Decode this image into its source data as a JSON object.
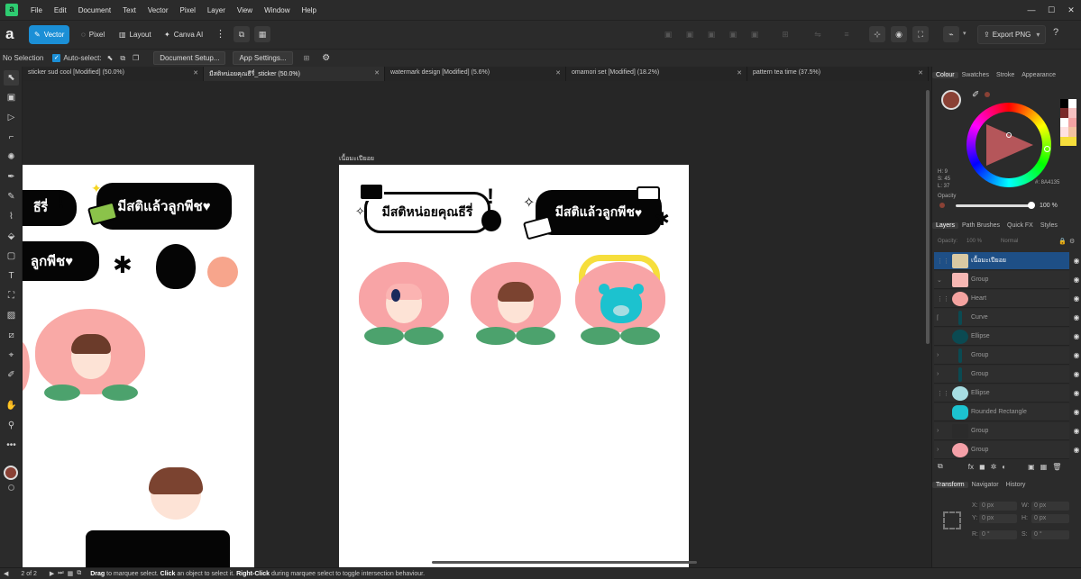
{
  "menubar": {
    "logo": "a",
    "items": [
      "File",
      "Edit",
      "Document",
      "Text",
      "Vector",
      "Pixel",
      "Layer",
      "View",
      "Window",
      "Help"
    ],
    "window_controls": [
      "—",
      "☐",
      "✕"
    ]
  },
  "toolbar": {
    "personas": [
      {
        "label": "Vector",
        "icon": "vector-persona-icon",
        "active": true
      },
      {
        "label": "Pixel",
        "icon": "pixel-persona-icon",
        "active": false
      },
      {
        "label": "Layout",
        "icon": "layout-persona-icon",
        "active": false
      },
      {
        "label": "Canva AI",
        "icon": "canva-ai-icon",
        "active": false
      }
    ],
    "export_label": "Export PNG",
    "accent_color": "#1b8fd6"
  },
  "contextbar": {
    "selection": "No Selection",
    "auto_select_label": "Auto-select:",
    "auto_select_checked": true,
    "document_setup": "Document Setup...",
    "app_settings": "App Settings..."
  },
  "tabs": [
    {
      "label": "sticker sud cool [Modified] (50.0%)",
      "active": false
    },
    {
      "label": "มีสติหน่อยคุณธีรี่_sticker (50.0%)",
      "active": true
    },
    {
      "label": "watermark design [Modified] (5.6%)",
      "active": false
    },
    {
      "label": "omamori set [Modified] (18.2%)",
      "active": false
    },
    {
      "label": "pattern tea time (37.5%)",
      "active": false
    }
  ],
  "canvas": {
    "artboard_label": "เนื้อมะเปียอย",
    "sticker_text_1": "มีสติหน่อยคุณธีรี่",
    "sticker_text_2": "มีสติแล้วลูกพีช",
    "left_sticker_text_1": "ธีรี่",
    "left_sticker_text_2": "ลูกพีช",
    "left_sticker_text_3": "มีสติแล้วลูกพีช"
  },
  "colour_panel": {
    "tabs": [
      "Colour",
      "Swatches",
      "Stroke",
      "Appearance"
    ],
    "h": "H: 9",
    "s": "S: 45",
    "l": "L: 37",
    "hex": "8A4135",
    "current_color": "#8A4135",
    "opacity_label": "Opacity",
    "opacity_value": "100 %"
  },
  "layers_panel": {
    "tabs": [
      "Layers",
      "Path Brushes",
      "Quick FX",
      "Styles"
    ],
    "opacity_label": "Opacity:",
    "opacity_value": "100 %",
    "blend_mode": "Normal",
    "layers": [
      {
        "name": "เนื้อมะเปียอย",
        "selected": true,
        "thumb": "#d9c9a3"
      },
      {
        "name": "Group",
        "selected": false,
        "thumb": "#f7b7b3"
      },
      {
        "name": "Heart",
        "selected": false,
        "thumb": "#f4a3a0"
      },
      {
        "name": "Curve",
        "selected": false,
        "thumb": "#0b4a52"
      },
      {
        "name": "Ellipse",
        "selected": false,
        "thumb": "#0b4a52"
      },
      {
        "name": "Group",
        "selected": false,
        "thumb": "#0b4a52"
      },
      {
        "name": "Group",
        "selected": false,
        "thumb": "#0b4a52"
      },
      {
        "name": "Ellipse",
        "selected": false,
        "thumb": "#a7dde2"
      },
      {
        "name": "Rounded Rectangle",
        "selected": false,
        "thumb": "#1cc2cf"
      },
      {
        "name": "Group",
        "selected": false,
        "thumb": "#2b2b2b"
      },
      {
        "name": "Group",
        "selected": false,
        "thumb": "#f4a0a8"
      }
    ]
  },
  "transform_panel": {
    "tabs": [
      "Transform",
      "Navigator",
      "History"
    ],
    "x": "0 px",
    "y": "0 px",
    "w": "0 px",
    "h": "0 px",
    "r": "0 °",
    "s": "0 °"
  },
  "statusbar": {
    "page": "2 of 2",
    "hint_1": "Drag",
    "hint_2": " to marquee select. ",
    "hint_3": "Click",
    "hint_4": " an object to select it. ",
    "hint_5": "Right-Click",
    "hint_6": " during marquee select to toggle intersection behaviour."
  }
}
